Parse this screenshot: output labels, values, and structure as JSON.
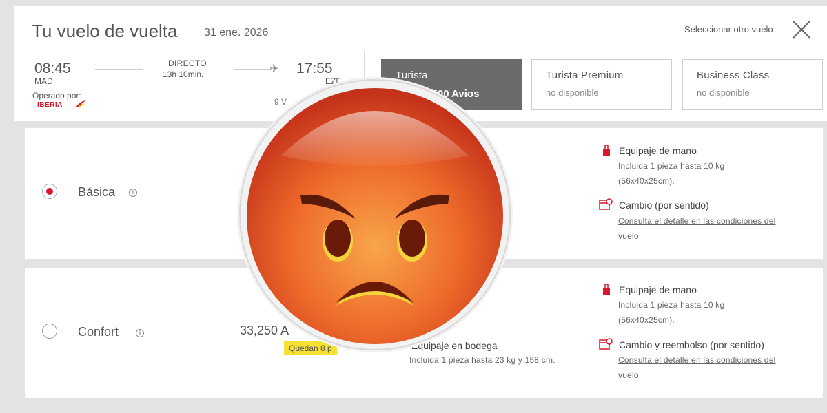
{
  "header": {
    "title": "Tu vuelo de vuelta",
    "date": "31 ene. 2026",
    "select_other": "Seleccionar otro vuelo"
  },
  "flight": {
    "departure_time": "08:45",
    "departure_code": "MAD",
    "arrival_time": "17:55",
    "arrival_code": "EZE",
    "type": "DIRECTO",
    "duration": "13h 10min.",
    "operated_by": "Operado por:",
    "airline_logo": "IBERIA",
    "partial_text": "9 V"
  },
  "fares": [
    {
      "name": "Turista",
      "sub": "5 500 Avios",
      "selected": true
    },
    {
      "name": "Turista Premium",
      "sub": "no disponible"
    },
    {
      "name": "Business Class",
      "sub": "no disponible"
    }
  ],
  "plans": [
    {
      "name": "Básica",
      "selected": true,
      "features": [
        {
          "title": "Equipaje de mano",
          "lines": [
            "Incluida 1 pieza hasta 10 kg",
            "(56x40x25cm)."
          ]
        },
        {
          "title": "Cambio (por sentido)",
          "link_lines": [
            "Consulta el detalle en las condiciones del",
            "vuelo"
          ]
        }
      ]
    },
    {
      "name": "Confort",
      "selected": false,
      "price": "33,250 A",
      "badge": "Quedan 8 p",
      "extra": {
        "title": "Equipaje en bodega",
        "text": "Incluida 1 pieza hasta 23 kg y 158 cm."
      },
      "features": [
        {
          "title": "Equipaje de mano",
          "lines": [
            "Incluida 1 pieza hasta 10 kg",
            "(56x40x25cm)."
          ]
        },
        {
          "title": "Cambio y reembolso (por sentido)",
          "link_lines": [
            "Consulta el detalle en las condiciones del",
            "vuelo"
          ]
        }
      ]
    }
  ],
  "overlay": {
    "icon": "angry-face-emoji-icon"
  },
  "colors": {
    "iberia_red": "#d7192d",
    "badge_yellow": "#f5e033",
    "selected_fare": "#6b6b6b"
  }
}
